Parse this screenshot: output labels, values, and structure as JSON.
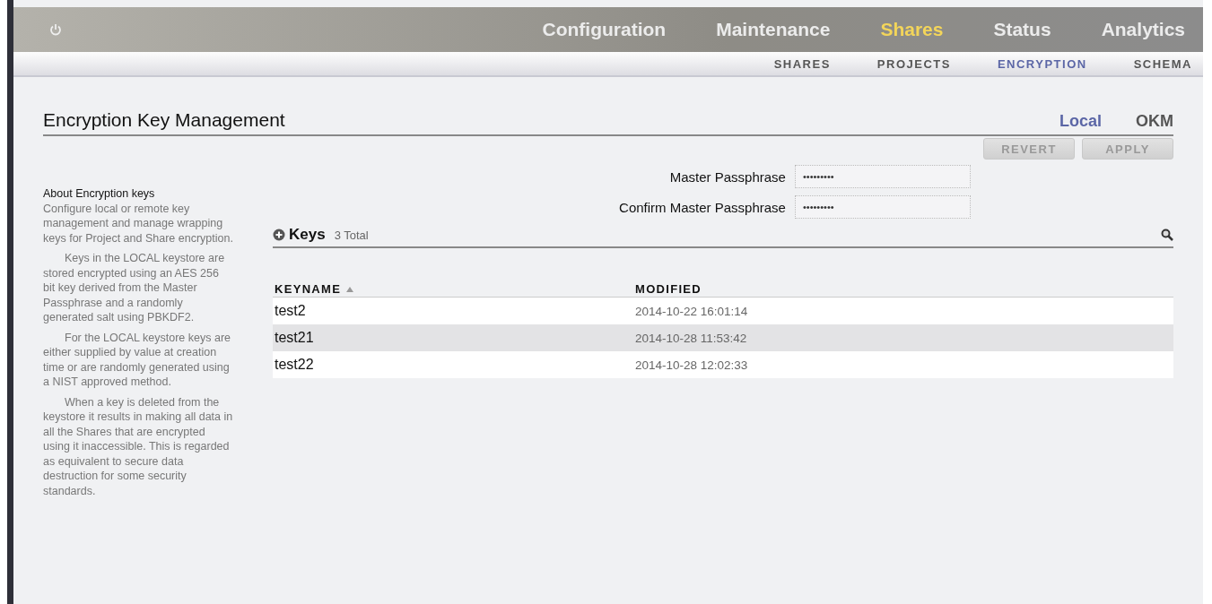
{
  "top_nav": {
    "items": [
      {
        "label": "Configuration",
        "selected": false
      },
      {
        "label": "Maintenance",
        "selected": false
      },
      {
        "label": "Shares",
        "selected": true
      },
      {
        "label": "Status",
        "selected": false
      },
      {
        "label": "Analytics",
        "selected": false
      }
    ]
  },
  "sub_nav": {
    "items": [
      {
        "label": "SHARES",
        "selected": false
      },
      {
        "label": "PROJECTS",
        "selected": false
      },
      {
        "label": "ENCRYPTION",
        "selected": true
      },
      {
        "label": "SCHEMA",
        "selected": false
      }
    ]
  },
  "page": {
    "title": "Encryption Key Management",
    "mode_tabs": [
      {
        "label": "Local",
        "selected": true
      },
      {
        "label": "OKM",
        "selected": false
      }
    ],
    "buttons": [
      {
        "label": "REVERT",
        "disabled": true
      },
      {
        "label": "APPLY",
        "disabled": true
      }
    ]
  },
  "about": {
    "title": "About Encryption keys",
    "paragraphs": [
      "Configure local or remote key management and manage wrapping keys for Project and Share encryption.",
      "Keys in the LOCAL keystore are stored encrypted using an AES 256 bit key derived from the Master Passphrase and a randomly generated salt using PBKDF2.",
      "For the LOCAL keystore keys are either supplied by value at creation time or are randomly generated using a NIST approved method.",
      "When a key is deleted from the keystore it results in making all data in all the Shares that are encrypted using it inaccessible. This is regarded as equivalent to secure data destruction for some security standards."
    ]
  },
  "fields": [
    {
      "label": "Master Passphrase",
      "value": "•••••••••"
    },
    {
      "label": "Confirm Master Passphrase",
      "value": "•••••••••"
    }
  ],
  "keys": {
    "title": "Keys",
    "count": "3 Total",
    "columns": [
      "KEYNAME",
      "MODIFIED"
    ],
    "rows": [
      {
        "keyname": "test2",
        "modified": "2014-10-22 16:01:14",
        "selected": false
      },
      {
        "keyname": "test21",
        "modified": "2014-10-28 11:53:42",
        "selected": true
      },
      {
        "keyname": "test22",
        "modified": "2014-10-28 12:02:33",
        "selected": false
      }
    ]
  }
}
